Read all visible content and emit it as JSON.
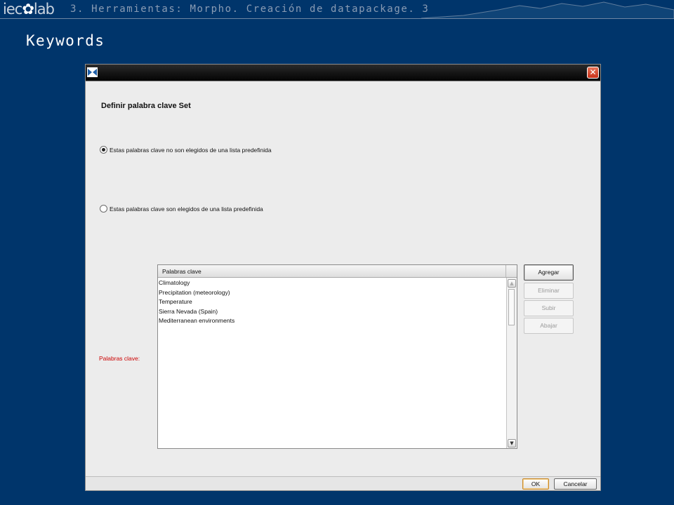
{
  "header": {
    "logo_text": "iecolab",
    "breadcrumb": "3. Herramientas: Morpho. Creación de datapackage. 3"
  },
  "slide": {
    "title": "Keywords"
  },
  "dialog": {
    "heading": "Definir palabra clave Set",
    "close_glyph": "✕",
    "options": [
      {
        "label": "Estas palabras clave no son elegidos de una lista predefinida",
        "checked": true
      },
      {
        "label": "Estas palabras clave son elegidos de una lista predefinida",
        "checked": false
      }
    ],
    "keywords_label": "Palabras clave:",
    "table": {
      "column_header": "Palabras clave",
      "rows": [
        "Climatology",
        "Precipitation (meteorology)",
        "Temperature",
        "Sierra Nevada (Spain)",
        "Mediterranean environments"
      ]
    },
    "side_buttons": [
      {
        "label": "Agregar",
        "enabled": true
      },
      {
        "label": "Eliminar",
        "enabled": false
      },
      {
        "label": "Subir",
        "enabled": false
      },
      {
        "label": "Abajar",
        "enabled": false
      }
    ],
    "footer": {
      "ok_label": "OK",
      "cancel_label": "Cancelar"
    }
  },
  "colors": {
    "background": "#00356b",
    "dialog_bg": "#ececec",
    "required_label": "#cc0000",
    "title_text": "#ffffff"
  },
  "icons": {
    "app_icon": "butterfly-icon",
    "close_icon": "close-icon",
    "scroll_up": "scroll-up-arrow-icon",
    "scroll_down": "scroll-down-arrow-icon"
  }
}
